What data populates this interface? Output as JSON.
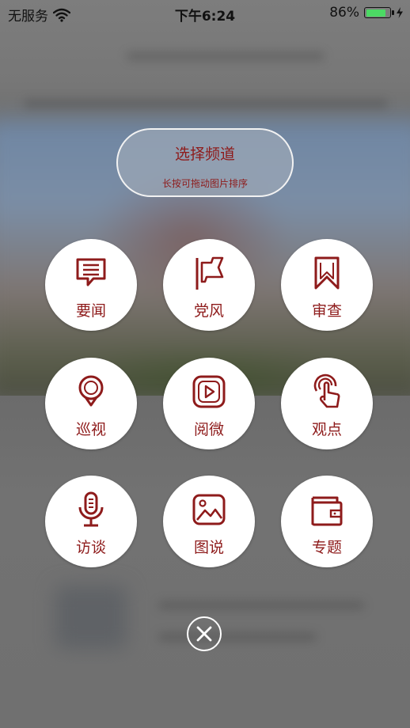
{
  "status_bar": {
    "carrier": "无服务",
    "time": "下午6:24",
    "battery_percent": "86%",
    "battery_level": 0.86,
    "battery_color": "#4cd964"
  },
  "header": {
    "title": "选择频道",
    "subtitle": "长按可拖动图片排序"
  },
  "channels": [
    {
      "label": "要闻",
      "icon": "news-chat-icon"
    },
    {
      "label": "党风",
      "icon": "flag-icon"
    },
    {
      "label": "审查",
      "icon": "bookmark-icon"
    },
    {
      "label": "巡视",
      "icon": "location-pin-icon"
    },
    {
      "label": "阅微",
      "icon": "play-video-icon"
    },
    {
      "label": "观点",
      "icon": "touch-gesture-icon"
    },
    {
      "label": "访谈",
      "icon": "microphone-icon"
    },
    {
      "label": "图说",
      "icon": "image-icon"
    },
    {
      "label": "专题",
      "icon": "folder-wallet-icon"
    }
  ],
  "close": {
    "icon": "close-icon"
  },
  "colors": {
    "accent": "#8e1b1b",
    "tile_background": "#ffffff"
  }
}
